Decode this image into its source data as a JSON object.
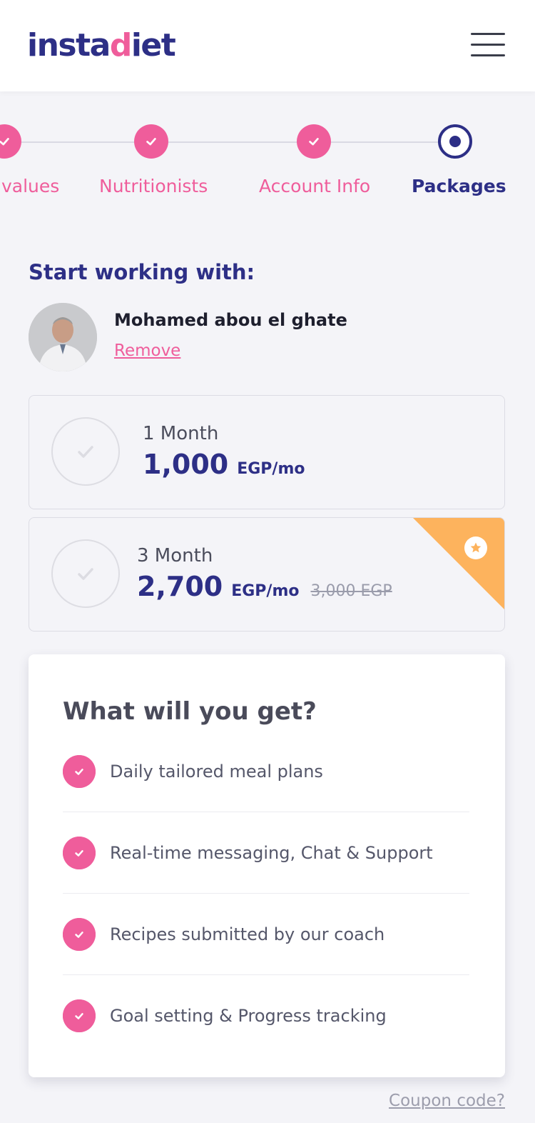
{
  "header": {
    "logo_part1": "insta",
    "logo_part2": "d",
    "logo_part3": "iet",
    "menu_icon": "hamburger-icon"
  },
  "stepper": {
    "steps": [
      {
        "label": "values",
        "state": "done"
      },
      {
        "label": "Nutritionists",
        "state": "done"
      },
      {
        "label": "Account Info",
        "state": "done"
      },
      {
        "label": "Packages",
        "state": "active"
      }
    ]
  },
  "selection": {
    "title": "Start working with:",
    "nutritionist_name": "Mohamed abou el ghate",
    "remove_label": "Remove"
  },
  "packages": [
    {
      "duration": "1 Month",
      "price": "1,000",
      "unit": "EGP/mo",
      "old_price": ""
    },
    {
      "duration": "3 Month",
      "price": "2,700",
      "unit": "EGP/mo",
      "old_price": "3,000 EGP",
      "badge_icon": "star-icon"
    }
  ],
  "benefits": {
    "title": "What will you get?",
    "items": [
      "Daily tailored meal plans",
      "Real-time messaging, Chat & Support",
      "Recipes submitted by our coach",
      "Goal setting & Progress tracking"
    ]
  },
  "coupon_label": "Coupon code?",
  "colors": {
    "brand": "#2d2f86",
    "accent": "#ef5d9b",
    "ribbon": "#fdb35d",
    "background": "#f4f4f8"
  }
}
